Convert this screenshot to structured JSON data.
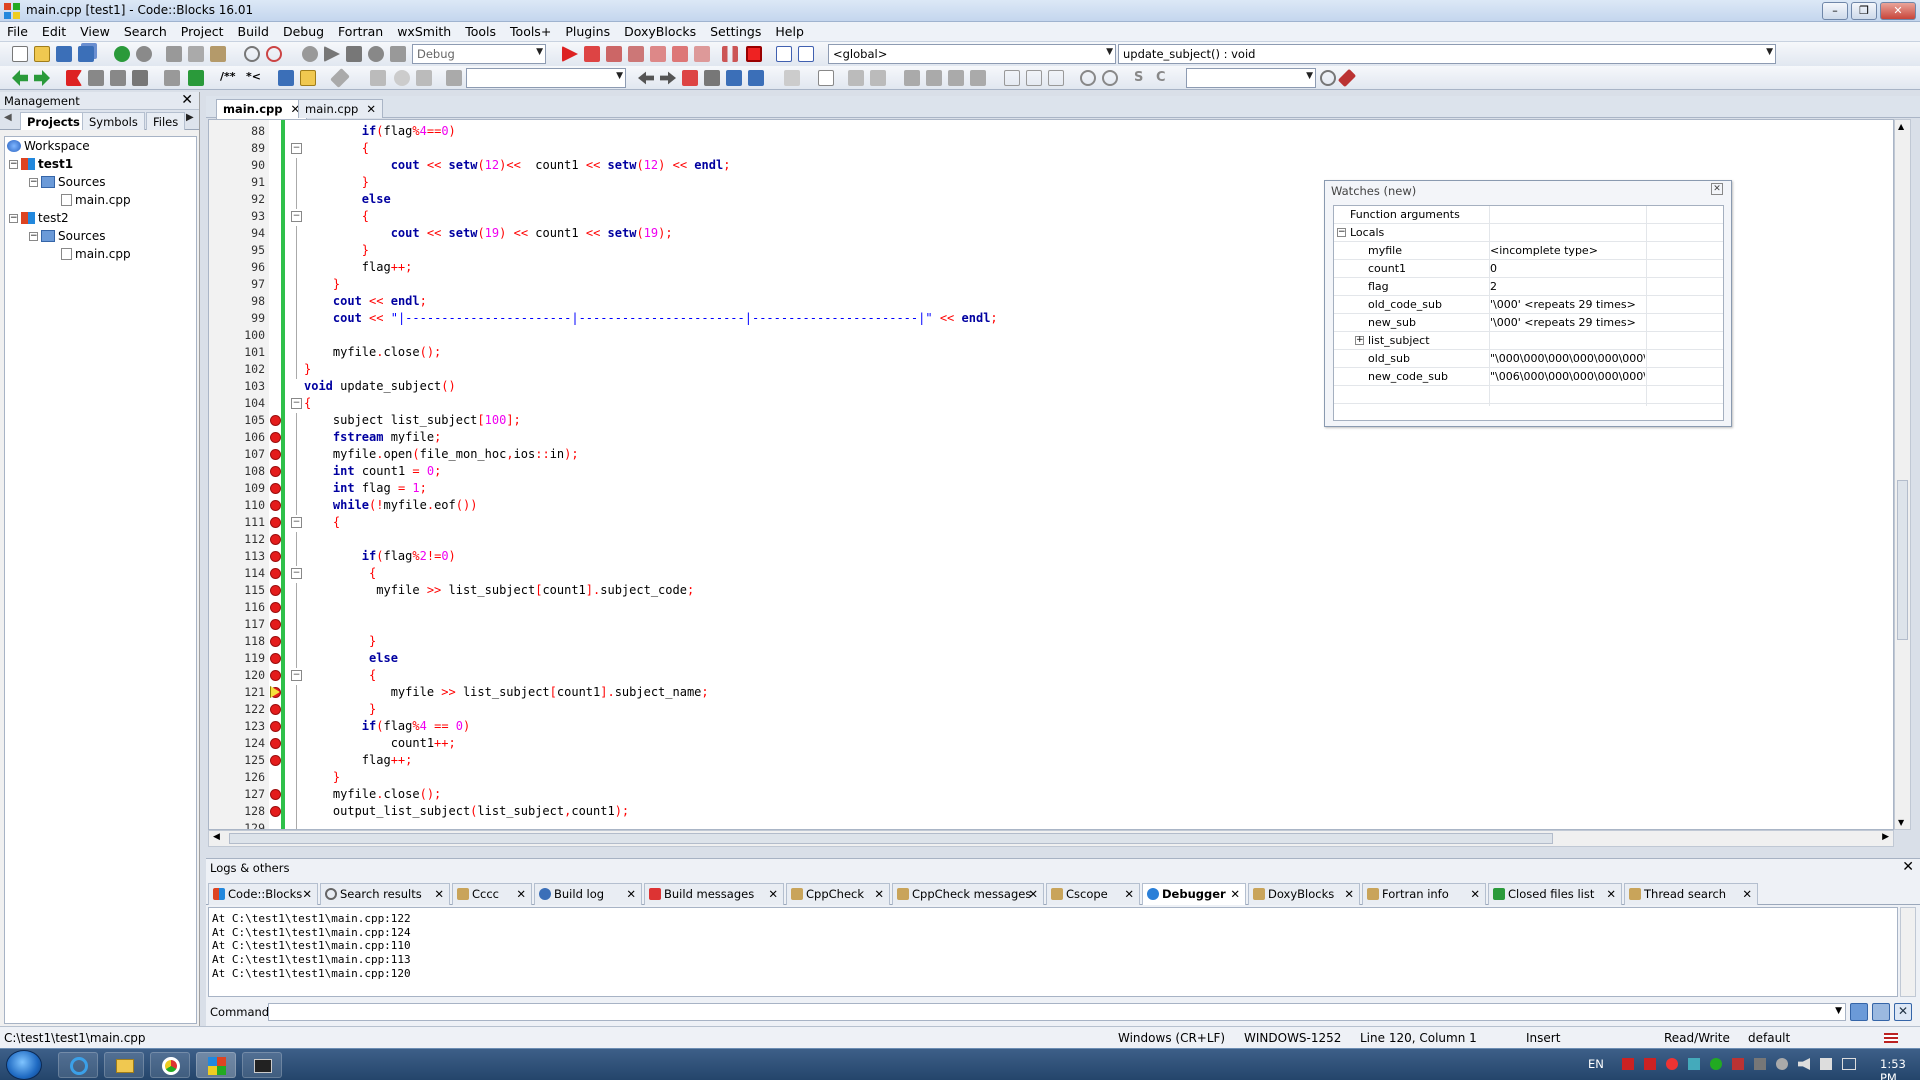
{
  "window": {
    "title": "main.cpp [test1] - Code::Blocks 16.01",
    "buttons": [
      "–",
      "❐",
      "✕"
    ]
  },
  "menu": [
    "File",
    "Edit",
    "View",
    "Search",
    "Project",
    "Build",
    "Debug",
    "Fortran",
    "wxSmith",
    "Tools",
    "Tools+",
    "Plugins",
    "DoxyBlocks",
    "Settings",
    "Help"
  ],
  "toolbar": {
    "build_target": "Debug",
    "scope": "<global>",
    "function": "update_subject() : void",
    "search_text": "",
    "search2_text": ""
  },
  "management": {
    "title": "Management",
    "close": "✕",
    "tabs": [
      "Projects",
      "Symbols",
      "Files"
    ],
    "nav_left": "◀",
    "nav_right": "▶",
    "tree": {
      "workspace": "Workspace",
      "projects": [
        {
          "name": "test1",
          "folder": "Sources",
          "file": "main.cpp"
        },
        {
          "name": "test2",
          "folder": "Sources",
          "file": "main.cpp"
        }
      ]
    }
  },
  "editor": {
    "tabs": [
      {
        "label": "main.cpp",
        "close": "✕"
      },
      {
        "label": "main.cpp",
        "close": "✕"
      }
    ],
    "current_line": "120"
  },
  "watches": {
    "title": "Watches (new)",
    "close": "✕",
    "rows": [
      {
        "name": "Function arguments",
        "value": ""
      },
      {
        "name": "Locals",
        "value": ""
      },
      {
        "name": "myfile",
        "value": "<incomplete type>"
      },
      {
        "name": "count1",
        "value": "0"
      },
      {
        "name": "flag",
        "value": "2"
      },
      {
        "name": "old_code_sub",
        "value": "'\\000' <repeats 29 times>"
      },
      {
        "name": "new_sub",
        "value": "'\\000' <repeats 29 times>"
      },
      {
        "name": "list_subject",
        "value": ""
      },
      {
        "name": "old_sub",
        "value": "\"\\000\\000\\000\\000\\000\\000\\b\\"
      },
      {
        "name": "new_code_sub",
        "value": "\"\\006\\000\\000\\000\\000\\000\\0C"
      }
    ]
  },
  "logs": {
    "title": "Logs & others",
    "close": "✕",
    "tabs": [
      "Code::Blocks",
      "Search results",
      "Cccc",
      "Build log",
      "Build messages",
      "CppCheck",
      "CppCheck messages",
      "Cscope",
      "Debugger",
      "DoxyBlocks",
      "Fortran info",
      "Closed files list",
      "Thread search"
    ],
    "active_tab": "Debugger",
    "lines": [
      "At C:\\test1\\test1\\main.cpp:122",
      "At C:\\test1\\test1\\main.cpp:124",
      "At C:\\test1\\test1\\main.cpp:110",
      "At C:\\test1\\test1\\main.cpp:113",
      "At C:\\test1\\test1\\main.cpp:120"
    ],
    "command_label": "Command:",
    "command_value": ""
  },
  "status": {
    "path": "C:\\test1\\test1\\main.cpp",
    "eol": "Windows (CR+LF)",
    "encoding": "WINDOWS-1252",
    "position": "Line 120, Column 1",
    "mode": "Insert",
    "access": "Read/Write",
    "profile": "default"
  },
  "taskbar": {
    "lang": "EN",
    "time": "1:53 PM"
  },
  "colors": {
    "breakpoint": "#e41c1c",
    "change_bar": "#2fc04a",
    "keyword": "#0000a0",
    "string": "#0000ff",
    "number": "#f000f0",
    "operator": "#ff0000"
  }
}
